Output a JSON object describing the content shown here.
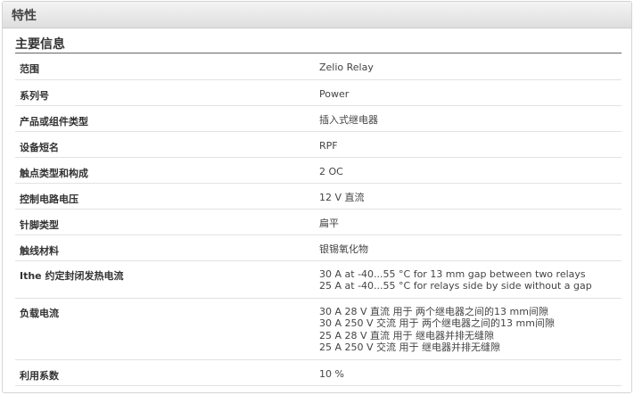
{
  "header": {
    "title": "特性"
  },
  "section": {
    "title": "主要信息"
  },
  "rows": [
    {
      "label": "范围",
      "values": [
        "Zelio Relay"
      ]
    },
    {
      "label": "系列号",
      "values": [
        "Power"
      ]
    },
    {
      "label": "产品或组件类型",
      "values": [
        "插入式继电器"
      ]
    },
    {
      "label": "设备短名",
      "values": [
        "RPF"
      ]
    },
    {
      "label": "触点类型和构成",
      "values": [
        "2 OC"
      ]
    },
    {
      "label": "控制电路电压",
      "values": [
        "12 V 直流"
      ]
    },
    {
      "label": "针脚类型",
      "values": [
        "扁平"
      ]
    },
    {
      "label": "触线材料",
      "values": [
        "银锡氧化物"
      ]
    },
    {
      "label": "Ithe 约定封闭发热电流",
      "values": [
        "30 A at -40...55 °C for 13 mm gap between two relays",
        "25 A at -40...55 °C for relays side by side without a gap"
      ]
    },
    {
      "label": "负载电流",
      "values": [
        "30 A 28 V 直流 用于 两个继电器之间的13 mm间隙",
        "30 A 250 V 交流 用于 两个继电器之间的13 mm间隙",
        "25 A 28 V 直流 用于 继电器并排无缝隙",
        "25 A 250 V 交流 用于 继电器并排无缝隙"
      ]
    },
    {
      "label": "利用系数",
      "values": [
        "10 %"
      ]
    }
  ]
}
